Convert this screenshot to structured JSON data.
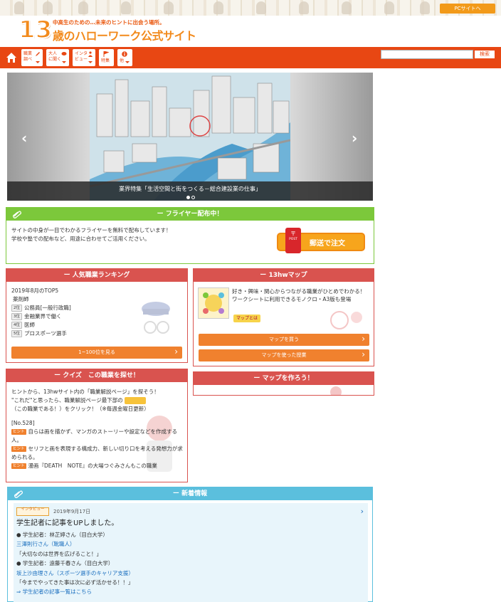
{
  "header": {
    "tagline": "中高生のための…未来のヒントに出会う場所。",
    "logo_number": "13",
    "logo_name": "歳のハローワーク公式サイト",
    "pc_site_button": "PCサイトへ"
  },
  "nav": {
    "home_icon": "home-icon",
    "items": [
      {
        "label": "職業\n調べ",
        "icon": "pencil-icon"
      },
      {
        "label": "大人\nに聞く",
        "icon": "chat-icon"
      },
      {
        "label": "インタ\nビュー",
        "icon": "person-icon"
      },
      {
        "label": "特集",
        "icon": "flag-icon"
      },
      {
        "label": "他",
        "icon": "info-icon"
      }
    ],
    "search_placeholder": "",
    "search_button": "検索"
  },
  "slider": {
    "caption": "業界特集「生活空間と街をつくる－総合建設業の仕事」",
    "prev": "‹",
    "next": "›",
    "dot_count": 2,
    "active_dot": 1
  },
  "flyer": {
    "title": "フライヤー配布中！",
    "line1": "サイトの中身が一目でわかるフライヤーを無料で配布しています！",
    "line2": "学校や塾での配布など、用途に合わせてご活用ください。",
    "order_button": "郵送で注文",
    "post_label": "POST"
  },
  "ranking": {
    "title": "人気職業ランキング",
    "period": "2019年8月のTOP5",
    "items": [
      {
        "rank": "",
        "label": "薬剤師"
      },
      {
        "rank": "2位",
        "label": "公務員[一般行政職]"
      },
      {
        "rank": "3位",
        "label": "金融業界で働く"
      },
      {
        "rank": "4位",
        "label": "医師"
      },
      {
        "rank": "5位",
        "label": "プロスポーツ選手"
      }
    ],
    "button": "1~100位を見る"
  },
  "map13": {
    "title": "13hwマップ",
    "desc1": "好き・興味・関心からつながる職業がひとめでわかる！",
    "desc2": "ワークシートに利用できるモノクロ・A3版も登場",
    "badge": "マップとは",
    "buy_button": "マップを買う",
    "class_button": "マップを使った授業"
  },
  "quiz": {
    "title": "クイズ　この職業を探せ！",
    "intro1": "ヒントから、13hwサイト内の「職業解説ページ」を探そう！",
    "intro2": "\"これだ\"と思ったら、職業解説ページ最下部の",
    "intro3": "（この職業である！）をクリック！（※毎週金曜日更新）",
    "number": "[No.528]",
    "hint_label": "ヒント",
    "hint1": "自らは画を描かず、マンガのストーリーや設定などを作成する人。",
    "hint2": "セリフと画を表現する構成力、新しい切り口を考える発想力が求められる。",
    "hint3": "漫画『DEATH　NOTE』の大場つぐみさんもこの職業"
  },
  "makemap": {
    "title": "マップを作ろう！"
  },
  "news": {
    "title": "新着情報",
    "badge": "インタビュー",
    "date": "2019年9月17日",
    "headline": "学生記者に記事をUPしました。",
    "lines": [
      {
        "text": "● 学生記者：林芷婷さん（目白大学）",
        "link": false
      },
      {
        "text": "三澤則行さん（靴職人）",
        "link": true
      },
      {
        "text": "「大切なのは世界を広げること！」",
        "link": false
      },
      {
        "text": "● 学生記者：遠藤千春さん（目白大学）",
        "link": false
      },
      {
        "text": "坂上沙由理さん（スポーツ選手のキャリア支援）",
        "link": true
      },
      {
        "text": "「今までやってきた事は次に必ず活かせる！！」",
        "link": false
      },
      {
        "text": "⇒ 学生記者の記事一覧はこちら",
        "link": true
      }
    ]
  },
  "colors": {
    "nav": "#e84713",
    "flyer": "#7cc83b",
    "red_box": "#d9534f",
    "orange_btn": "#f0812e",
    "news": "#5bbfdd"
  }
}
